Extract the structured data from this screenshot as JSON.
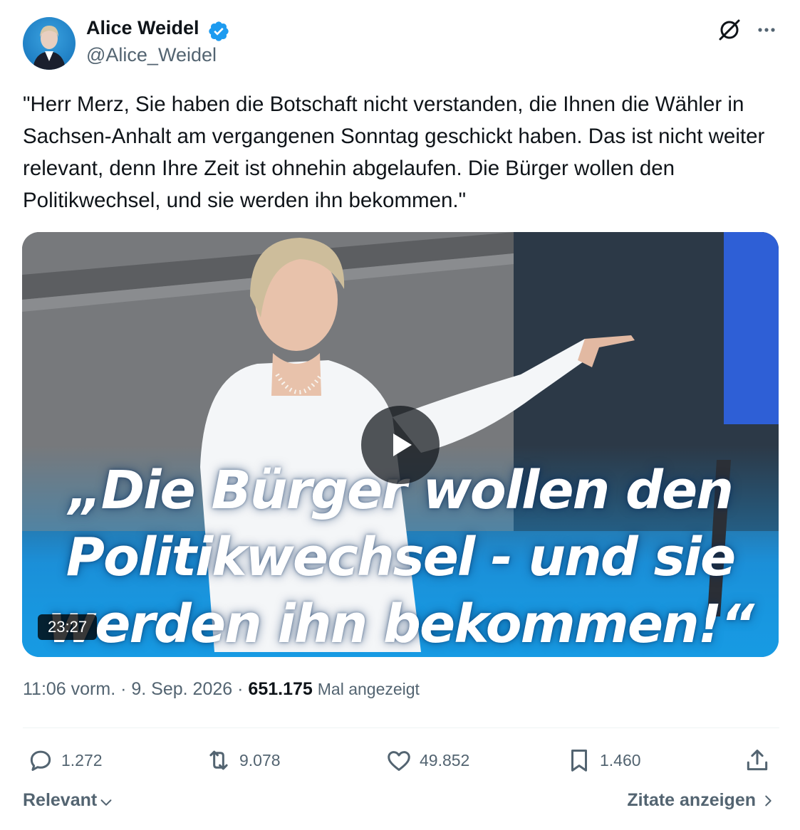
{
  "author": {
    "name": "Alice Weidel",
    "handle": "@Alice_Weidel"
  },
  "tweet": {
    "text": "\"Herr Merz, Sie haben die Botschaft nicht verstanden, die Ihnen die Wähler in Sachsen-Anhalt am vergangenen Sonntag geschickt haben. Das ist nicht weiter relevant, denn Ihre Zeit ist ohnehin abgelaufen. Die Bürger wollen den Politikwechsel, und sie werden ihn bekommen.\""
  },
  "media": {
    "overlay_lines": [
      "„Die Bürger wollen den",
      "Politikwechsel - und sie",
      "werden ihn bekommen!“"
    ],
    "duration": "23:27"
  },
  "meta": {
    "time": "11:06 vorm.",
    "separator": "·",
    "date": "9. Sep. 2026",
    "views_count": "651.175",
    "views_label": "Mal angezeigt"
  },
  "actions": {
    "replies": "1.272",
    "reposts": "9.078",
    "likes": "49.852",
    "bookmarks": "1.460"
  },
  "footer": {
    "sort_label": "Relevant",
    "quotes_label": "Zitate anzeigen"
  },
  "colors": {
    "text_primary": "#0f1419",
    "text_secondary": "#536471",
    "verified_blue": "#1d9bf0",
    "divider": "#eff3f4",
    "overlay_blue": "#179ae3"
  },
  "icons": [
    "verified-badge-icon",
    "grok-icon",
    "more-icon",
    "play-icon",
    "reply-icon",
    "repost-icon",
    "like-icon",
    "bookmark-icon",
    "share-icon",
    "chevron-down-icon",
    "chevron-right-icon"
  ]
}
